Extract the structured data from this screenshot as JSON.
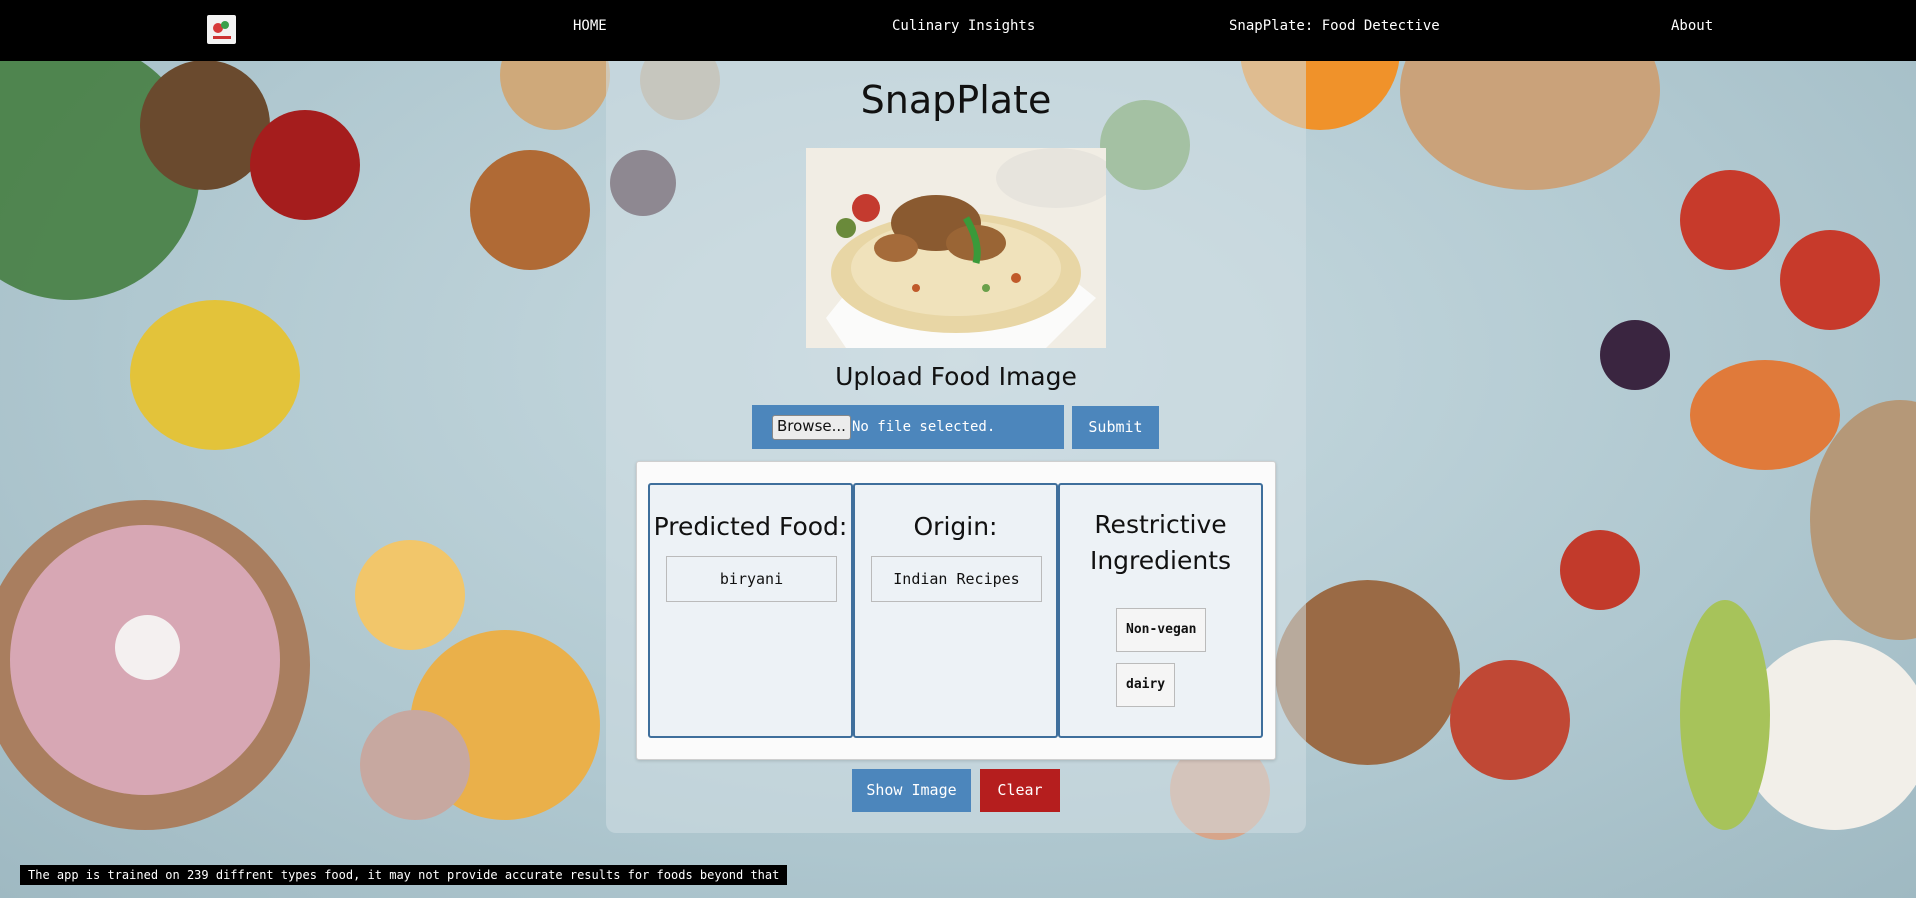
{
  "nav": {
    "logo_icon": "snapplate-logo",
    "items": [
      {
        "label": "HOME"
      },
      {
        "label": "Culinary Insights"
      },
      {
        "label": "SnapPlate: Food Detective"
      },
      {
        "label": "About"
      }
    ]
  },
  "main": {
    "title": "SnapPlate",
    "upload_label": "Upload Food Image",
    "browse_label": "Browse...",
    "file_status": "No file selected.",
    "submit_label": "Submit"
  },
  "results": {
    "predicted": {
      "heading": "Predicted Food:",
      "value": "biryani"
    },
    "origin": {
      "heading": "Origin:",
      "value": "Indian Recipes"
    },
    "restrictive": {
      "heading": "Restrictive Ingredients",
      "tags": [
        "Non-vegan",
        "dairy"
      ]
    }
  },
  "actions": {
    "show_image_label": "Show Image",
    "clear_label": "Clear"
  },
  "footer": {
    "disclaimer": "The app is trained on 239 diffrent types food, it may not provide accurate results for foods beyond that"
  },
  "colors": {
    "nav_bg": "#000000",
    "primary_button": "#4c86bc",
    "danger_button": "#b51e1e",
    "card_border": "#3f6f9c"
  }
}
